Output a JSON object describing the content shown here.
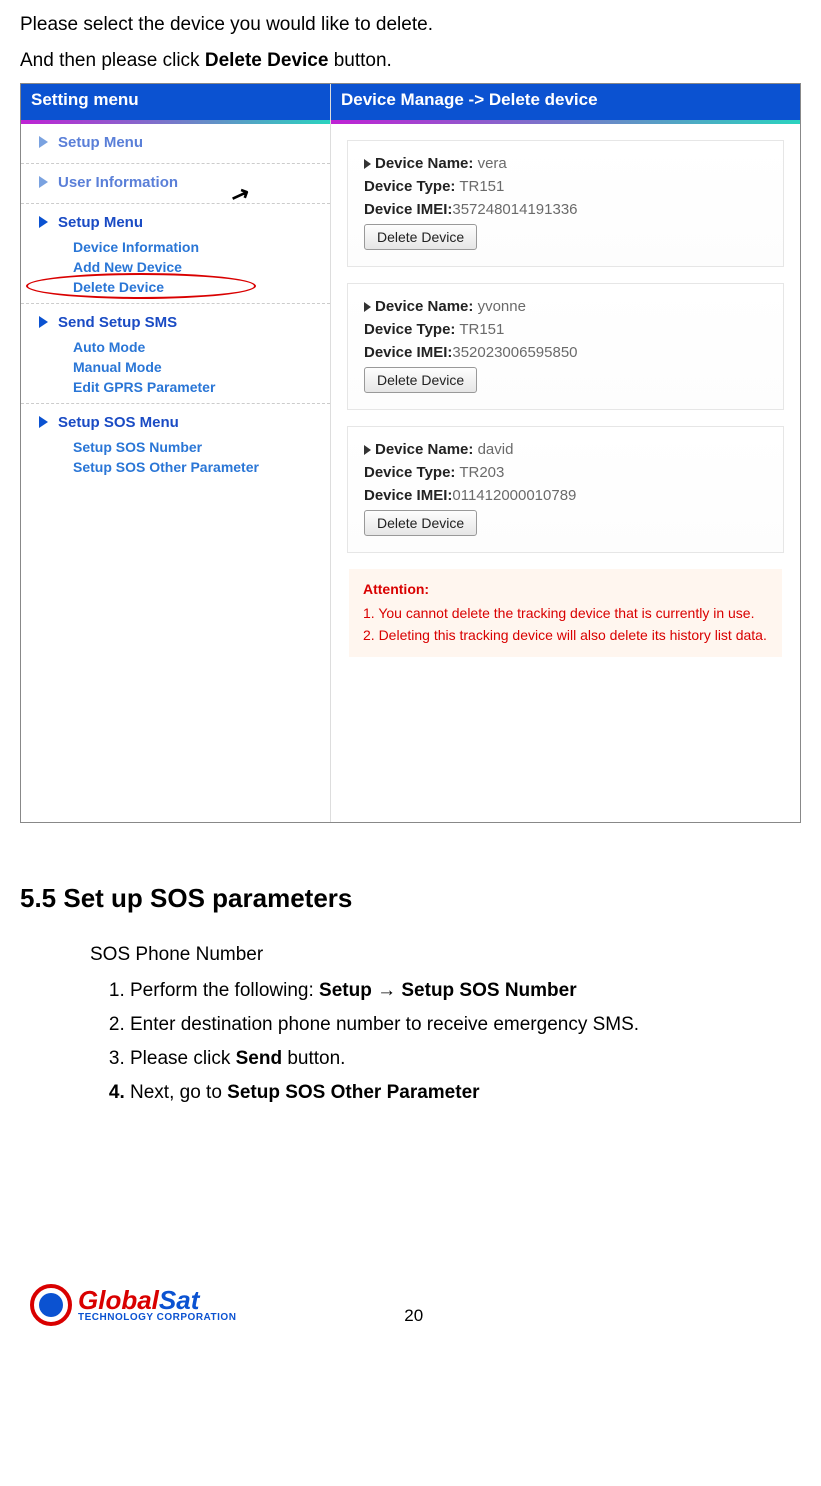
{
  "intro": {
    "line1": "Please select the device you would like to delete.",
    "line2_pre": "And then please click ",
    "line2_bold": "Delete Device",
    "line2_post": " button."
  },
  "sidebar": {
    "header": "Setting menu",
    "items": {
      "setup_menu_top": "Setup Menu",
      "user_information": "User Information",
      "setup_menu_group": "Setup Menu",
      "device_information": "Device Information",
      "add_new_device": "Add New Device",
      "delete_device": "Delete Device",
      "send_setup_sms": "Send Setup SMS",
      "auto_mode": "Auto Mode",
      "manual_mode": "Manual Mode",
      "edit_gprs": "Edit GPRS Parameter",
      "setup_sos_menu": "Setup SOS Menu",
      "setup_sos_number": "Setup SOS Number",
      "setup_sos_other": "Setup SOS Other Parameter"
    }
  },
  "main": {
    "header": "Device Manage -> Delete device",
    "labels": {
      "device_name": "Device Name:",
      "device_type": "Device Type:",
      "device_imei": "Device IMEI:",
      "delete_btn": "Delete Device"
    },
    "devices": [
      {
        "name": "vera",
        "type": "TR151",
        "imei": "357248014191336"
      },
      {
        "name": "yvonne",
        "type": "TR151",
        "imei": "352023006595850"
      },
      {
        "name": "david",
        "type": "TR203",
        "imei": "011412000010789"
      }
    ],
    "attention": {
      "title": "Attention:",
      "line1": "1. You cannot delete the tracking device that is currently in use.",
      "line2": "2. Deleting this tracking device will also delete its history list data."
    }
  },
  "section": {
    "heading": "5.5 Set up SOS parameters",
    "sub": "SOS Phone Number",
    "steps": {
      "s1_pre": "Perform the following: ",
      "s1_b1": "Setup",
      "s1_arrow": " → ",
      "s1_b2": "Setup SOS Number",
      "s2": "Enter destination phone number to receive emergency SMS.",
      "s3_pre": "Please click ",
      "s3_bold": "Send",
      "s3_post": " button.",
      "s4_pre": "Next, go to ",
      "s4_bold": "Setup SOS Other Parameter"
    }
  },
  "footer": {
    "page": "20",
    "logo_global": "Global",
    "logo_sat": "Sat",
    "logo_sub": "TECHNOLOGY CORPORATION"
  }
}
